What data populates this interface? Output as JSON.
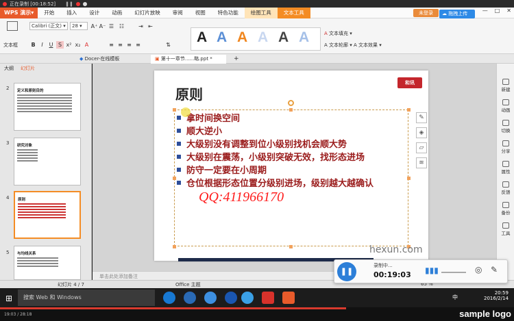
{
  "recorder_top": {
    "status": "正在录制 [00:18:52]"
  },
  "menu": {
    "app": "WPS 演示",
    "items": [
      "开始",
      "插入",
      "设计",
      "动画",
      "幻灯片放映",
      "审阅",
      "视图",
      "特色功能",
      "绘图工具",
      "文本工具"
    ],
    "login": "未登录"
  },
  "ribbon": {
    "textbox": "文本框",
    "font": "Calibri (正文)",
    "size": "28",
    "fill": "文本填充",
    "outline": "文本轮廓",
    "effect": "文本效果"
  },
  "doc_tabs": {
    "template": "Docer-在线模板",
    "file": "第十一章节......略.ppt *",
    "add": "+"
  },
  "left_panel": {
    "tab_outline": "大纲",
    "tab_slides": "幻灯片",
    "thumbs": [
      {
        "num": "2",
        "title": "定义和原则目的"
      },
      {
        "num": "3",
        "title": "研究对象"
      },
      {
        "num": "4",
        "title": "原则"
      },
      {
        "num": "5",
        "title": "与均线关系"
      }
    ]
  },
  "slide": {
    "title": "原则",
    "logo": "和讯",
    "bullets": [
      "拿时间换空间",
      "顺大逆小",
      "大级别没有调整到位小级别找机会顺大势",
      "大级别在震荡，小级别突破无效，找形态进场",
      "防守一定要在小周期",
      "仓位根据形态位置分级别进场，级别越大越确认"
    ],
    "watermark": "QQ:411966170",
    "brand": "hexun.com"
  },
  "notes": {
    "placeholder": "单击此处添加备注"
  },
  "right_panel": {
    "items": [
      "新建",
      "动画",
      "切换",
      "分享",
      "属性",
      "反馈",
      "备份",
      "工具"
    ]
  },
  "status": {
    "slide_count": "幻灯片 4 / 7",
    "theme": "Office 主题",
    "zoom": "65 %"
  },
  "recorder": {
    "label": "录制中...",
    "time": "00:19:03"
  },
  "upload": "拖拽上传",
  "taskbar": {
    "search": "搜索 Web 和 Windows",
    "time": "20:59",
    "date": "2016/2/14",
    "lang": "中"
  },
  "player": {
    "position": "19:03 / 28:18",
    "progress": 0.673,
    "logo": "sample logo"
  },
  "colors": {
    "accent": "#f48c24",
    "bullet_text": "#9a1b1b",
    "watermark": "#ff1c1c",
    "bullet_square": "#2e4e9a"
  }
}
